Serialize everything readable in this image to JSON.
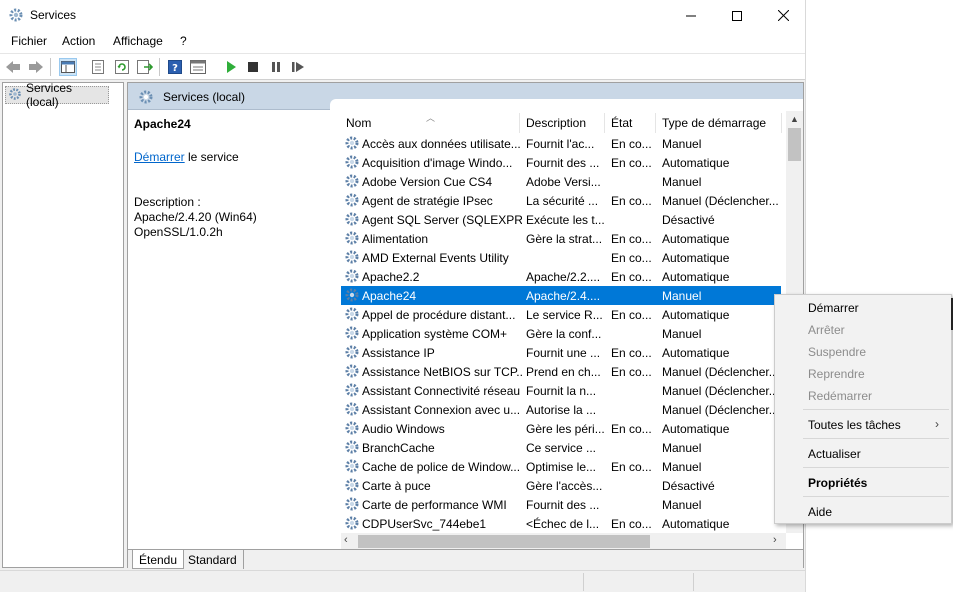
{
  "window": {
    "title": "Services",
    "icon": "gear-icon"
  },
  "menu": [
    "Fichier",
    "Action",
    "Affichage",
    "?"
  ],
  "tree": {
    "node_label": "Services (local)"
  },
  "main": {
    "header_title": "Services (local)",
    "selected_service": "Apache24",
    "start_link": "Démarrer",
    "start_suffix": " le service",
    "description_label": "Description :",
    "description_lines": [
      "Apache/2.4.20 (Win64)",
      "OpenSSL/1.0.2h"
    ]
  },
  "columns": [
    "Nom",
    "Description",
    "État",
    "Type de démarrage"
  ],
  "rows": [
    {
      "name": "Accès aux données utilisate...",
      "desc": "Fournit l'ac...",
      "state": "En co...",
      "start": "Manuel"
    },
    {
      "name": "Acquisition d'image Windo...",
      "desc": "Fournit des ...",
      "state": "En co...",
      "start": "Automatique"
    },
    {
      "name": "Adobe Version Cue CS4",
      "desc": "Adobe Versi...",
      "state": "",
      "start": "Manuel"
    },
    {
      "name": "Agent de stratégie IPsec",
      "desc": "La sécurité ...",
      "state": "En co...",
      "start": "Manuel (Déclencher..."
    },
    {
      "name": "Agent SQL Server (SQLEXPR...",
      "desc": "Exécute les t...",
      "state": "",
      "start": "Désactivé"
    },
    {
      "name": "Alimentation",
      "desc": "Gère la strat...",
      "state": "En co...",
      "start": "Automatique"
    },
    {
      "name": "AMD External Events Utility",
      "desc": "",
      "state": "En co...",
      "start": "Automatique"
    },
    {
      "name": "Apache2.2",
      "desc": "Apache/2.2....",
      "state": "En co...",
      "start": "Automatique"
    },
    {
      "name": "Apache24",
      "desc": "Apache/2.4....",
      "state": "",
      "start": "Manuel"
    },
    {
      "name": "Appel de procédure distant...",
      "desc": "Le service R...",
      "state": "En co...",
      "start": "Automatique"
    },
    {
      "name": "Application système COM+",
      "desc": "Gère la conf...",
      "state": "",
      "start": "Manuel"
    },
    {
      "name": "Assistance IP",
      "desc": "Fournit une ...",
      "state": "En co...",
      "start": "Automatique"
    },
    {
      "name": "Assistance NetBIOS sur TCP...",
      "desc": "Prend en ch...",
      "state": "En co...",
      "start": "Manuel (Déclencher..."
    },
    {
      "name": "Assistant Connectivité réseau",
      "desc": "Fournit la n...",
      "state": "",
      "start": "Manuel (Déclencher..."
    },
    {
      "name": "Assistant Connexion avec u...",
      "desc": "Autorise la ...",
      "state": "",
      "start": "Manuel (Déclencher..."
    },
    {
      "name": "Audio Windows",
      "desc": "Gère les péri...",
      "state": "En co...",
      "start": "Automatique"
    },
    {
      "name": "BranchCache",
      "desc": "Ce service ...",
      "state": "",
      "start": "Manuel"
    },
    {
      "name": "Cache de police de Window...",
      "desc": "Optimise le...",
      "state": "En co...",
      "start": "Manuel"
    },
    {
      "name": "Carte à puce",
      "desc": "Gère l'accès...",
      "state": "",
      "start": "Désactivé"
    },
    {
      "name": "Carte de performance WMI",
      "desc": "Fournit des ...",
      "state": "",
      "start": "Manuel"
    },
    {
      "name": "CDPUserSvc_744ebe1",
      "desc": "<Échec de l...",
      "state": "En co...",
      "start": "Automatique"
    }
  ],
  "selected_index": 8,
  "tabs": [
    "Étendu",
    "Standard"
  ],
  "context_menu": {
    "items": [
      "Démarrer",
      "Arrêter",
      "Suspendre",
      "Reprendre",
      "Redémarrer",
      "Toutes les tâches",
      "Actualiser",
      "Propriétés",
      "Aide"
    ],
    "submenu_arrow": "›"
  },
  "colors": {
    "selection": "#0078d7",
    "header_bg": "#c9d7e6",
    "link": "#0066cc"
  }
}
